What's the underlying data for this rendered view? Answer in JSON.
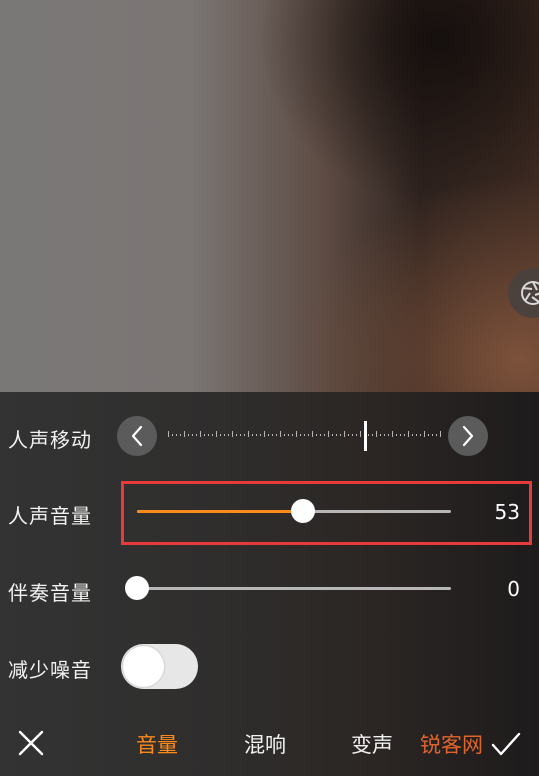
{
  "controls": {
    "voice_shift": {
      "label": "人声移动",
      "position": 0.72
    },
    "voice_volume": {
      "label": "人声音量",
      "value": "53",
      "level": 0.53
    },
    "accompaniment_volume": {
      "label": "伴奏音量",
      "value": "0",
      "level": 0.0
    },
    "noise_reduction": {
      "label": "减少噪音",
      "enabled": false
    }
  },
  "tabs": [
    {
      "label": "音量",
      "active": true
    },
    {
      "label": "混响",
      "active": false
    },
    {
      "label": "变声",
      "active": false
    }
  ],
  "watermark": "锐客网",
  "icons": {
    "close": "close-icon",
    "confirm": "check-icon",
    "shutter": "camera-shutter-icon",
    "left": "chevron-left-icon",
    "right": "chevron-right-icon"
  },
  "colors": {
    "accent": "#ff8a1c",
    "highlight": "#e83a3a"
  }
}
